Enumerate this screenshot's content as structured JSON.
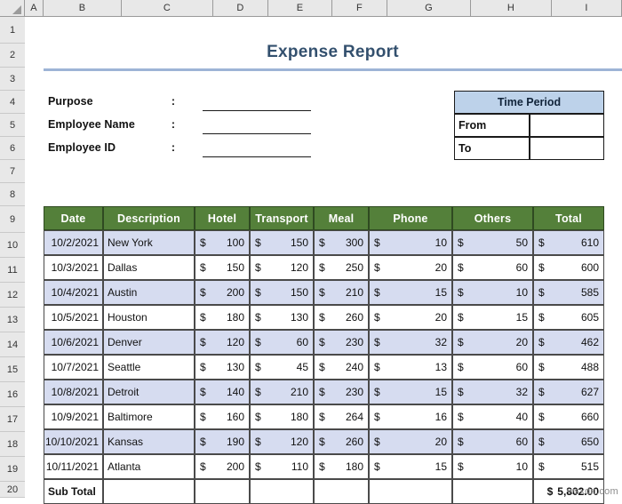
{
  "spreadsheet": {
    "column_headers": [
      "A",
      "B",
      "C",
      "D",
      "E",
      "F",
      "G",
      "H",
      "I"
    ],
    "row_headers": [
      "1",
      "2",
      "3",
      "4",
      "5",
      "6",
      "7",
      "8",
      "9",
      "10",
      "11",
      "12",
      "13",
      "14",
      "15",
      "16",
      "17",
      "18",
      "19",
      "20"
    ]
  },
  "title": "Expense Report",
  "form": {
    "rows": [
      {
        "label": "Purpose",
        "colon": ":",
        "value": ""
      },
      {
        "label": "Employee Name",
        "colon": ":",
        "value": ""
      },
      {
        "label": "Employee ID",
        "colon": ":",
        "value": ""
      }
    ]
  },
  "time_period": {
    "heading": "Time Period",
    "rows": [
      {
        "label": "From",
        "value": ""
      },
      {
        "label": "To",
        "value": ""
      }
    ]
  },
  "table": {
    "headers": [
      "Date",
      "Description",
      "Hotel",
      "Transport",
      "Meal",
      "Phone",
      "Others",
      "Total"
    ],
    "currency_symbol": "$",
    "rows": [
      {
        "date": "10/2/2021",
        "description": "New York",
        "hotel": "100",
        "transport": "150",
        "meal": "300",
        "phone": "10",
        "others": "50",
        "total": "610"
      },
      {
        "date": "10/3/2021",
        "description": "Dallas",
        "hotel": "150",
        "transport": "120",
        "meal": "250",
        "phone": "20",
        "others": "60",
        "total": "600"
      },
      {
        "date": "10/4/2021",
        "description": "Austin",
        "hotel": "200",
        "transport": "150",
        "meal": "210",
        "phone": "15",
        "others": "10",
        "total": "585"
      },
      {
        "date": "10/5/2021",
        "description": "Houston",
        "hotel": "180",
        "transport": "130",
        "meal": "260",
        "phone": "20",
        "others": "15",
        "total": "605"
      },
      {
        "date": "10/6/2021",
        "description": "Denver",
        "hotel": "120",
        "transport": "60",
        "meal": "230",
        "phone": "32",
        "others": "20",
        "total": "462"
      },
      {
        "date": "10/7/2021",
        "description": "Seattle",
        "hotel": "130",
        "transport": "45",
        "meal": "240",
        "phone": "13",
        "others": "60",
        "total": "488"
      },
      {
        "date": "10/8/2021",
        "description": "Detroit",
        "hotel": "140",
        "transport": "210",
        "meal": "230",
        "phone": "15",
        "others": "32",
        "total": "627"
      },
      {
        "date": "10/9/2021",
        "description": "Baltimore",
        "hotel": "160",
        "transport": "180",
        "meal": "264",
        "phone": "16",
        "others": "40",
        "total": "660"
      },
      {
        "date": "10/10/2021",
        "description": "Kansas",
        "hotel": "190",
        "transport": "120",
        "meal": "260",
        "phone": "20",
        "others": "60",
        "total": "650"
      },
      {
        "date": "10/11/2021",
        "description": "Atlanta",
        "hotel": "200",
        "transport": "110",
        "meal": "180",
        "phone": "15",
        "others": "10",
        "total": "515"
      }
    ],
    "subtotal": {
      "label": "Sub Total",
      "currency_symbol": "$",
      "value": "5,802.00"
    }
  },
  "watermark": "wsxdn.com",
  "colors": {
    "title_text": "#33506e",
    "title_rule": "#9db4d6",
    "table_header_green": "#54803a",
    "band_row": "#d6dcf0",
    "time_period_header": "#bdd2ea"
  }
}
